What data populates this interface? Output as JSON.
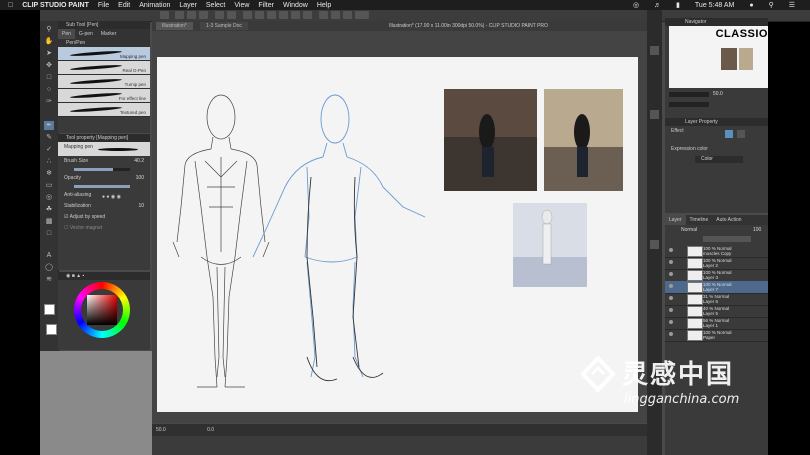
{
  "menubar": {
    "app": "CLIP STUDIO PAINT",
    "items": [
      "File",
      "Edit",
      "Animation",
      "Layer",
      "Select",
      "View",
      "Filter",
      "Window",
      "Help"
    ],
    "clock": "Tue 5:48 AM"
  },
  "subtool": {
    "title": "Sub Tool [Pen]",
    "tabs": [
      "Pen",
      "G-pen",
      "Marker"
    ],
    "group": "Pen/Pen",
    "brushes": [
      "Mapping pen",
      "Real G-Pen",
      "Turnip pen",
      "For effect line",
      "Textured pen"
    ]
  },
  "toolprop": {
    "title": "Tool property [Mapping pen]",
    "brush_name": "Mapping pen",
    "rows": [
      {
        "label": "Brush Size",
        "value": "40.2"
      },
      {
        "label": "Opacity",
        "value": "100"
      },
      {
        "label": "Anti-aliasing",
        "value": ""
      },
      {
        "label": "Stabilization",
        "value": "10"
      },
      {
        "label": "Adjust by speed",
        "value": ""
      },
      {
        "label": "Vector magnet",
        "value": ""
      }
    ],
    "opacity_fraction": 1.0,
    "size_fraction": 0.7
  },
  "canvas": {
    "tabs": [
      "Illustration*",
      "1-3 Sample Doc"
    ],
    "title": "Illustration* (17.00 x 11.00in 300dpi 50.0%) - CLIP STUDIO PAINT PRO",
    "zoom": "50.0",
    "angle": "0.0"
  },
  "navigator": {
    "title": "Navigator",
    "brand": "CLASSIO",
    "zoom": "50.0"
  },
  "layerprop": {
    "title": "Layer Property",
    "effect": "Effect",
    "expression_label": "Expression color",
    "expression_value": "Color"
  },
  "layers": {
    "tabs": [
      "Layer",
      "Timeline",
      "Auto Action"
    ],
    "blend": "Normal",
    "opacity": "100",
    "rows": [
      {
        "line1": "100 % Normal",
        "line2": "muscles Copy"
      },
      {
        "line1": "100 % Normal",
        "line2": "Layer 2"
      },
      {
        "line1": "100 % Normal",
        "line2": "Layer 3"
      },
      {
        "line1": "100 % Normal",
        "line2": "Layer 7"
      },
      {
        "line1": "31 % Normal",
        "line2": "Layer 6"
      },
      {
        "line1": "40 % Normal",
        "line2": "Layer 5"
      },
      {
        "line1": "56 % Normal",
        "line2": "Layer 1"
      },
      {
        "line1": "100 % Normal",
        "line2": "Paper"
      }
    ],
    "selected_index": 3
  },
  "colors": {
    "accent": "#4d6a8c",
    "panel": "#3a3a3a",
    "paper": "#f4f4f4"
  },
  "watermark": {
    "cn": "灵感中国",
    "en": "lingganchina.com"
  }
}
